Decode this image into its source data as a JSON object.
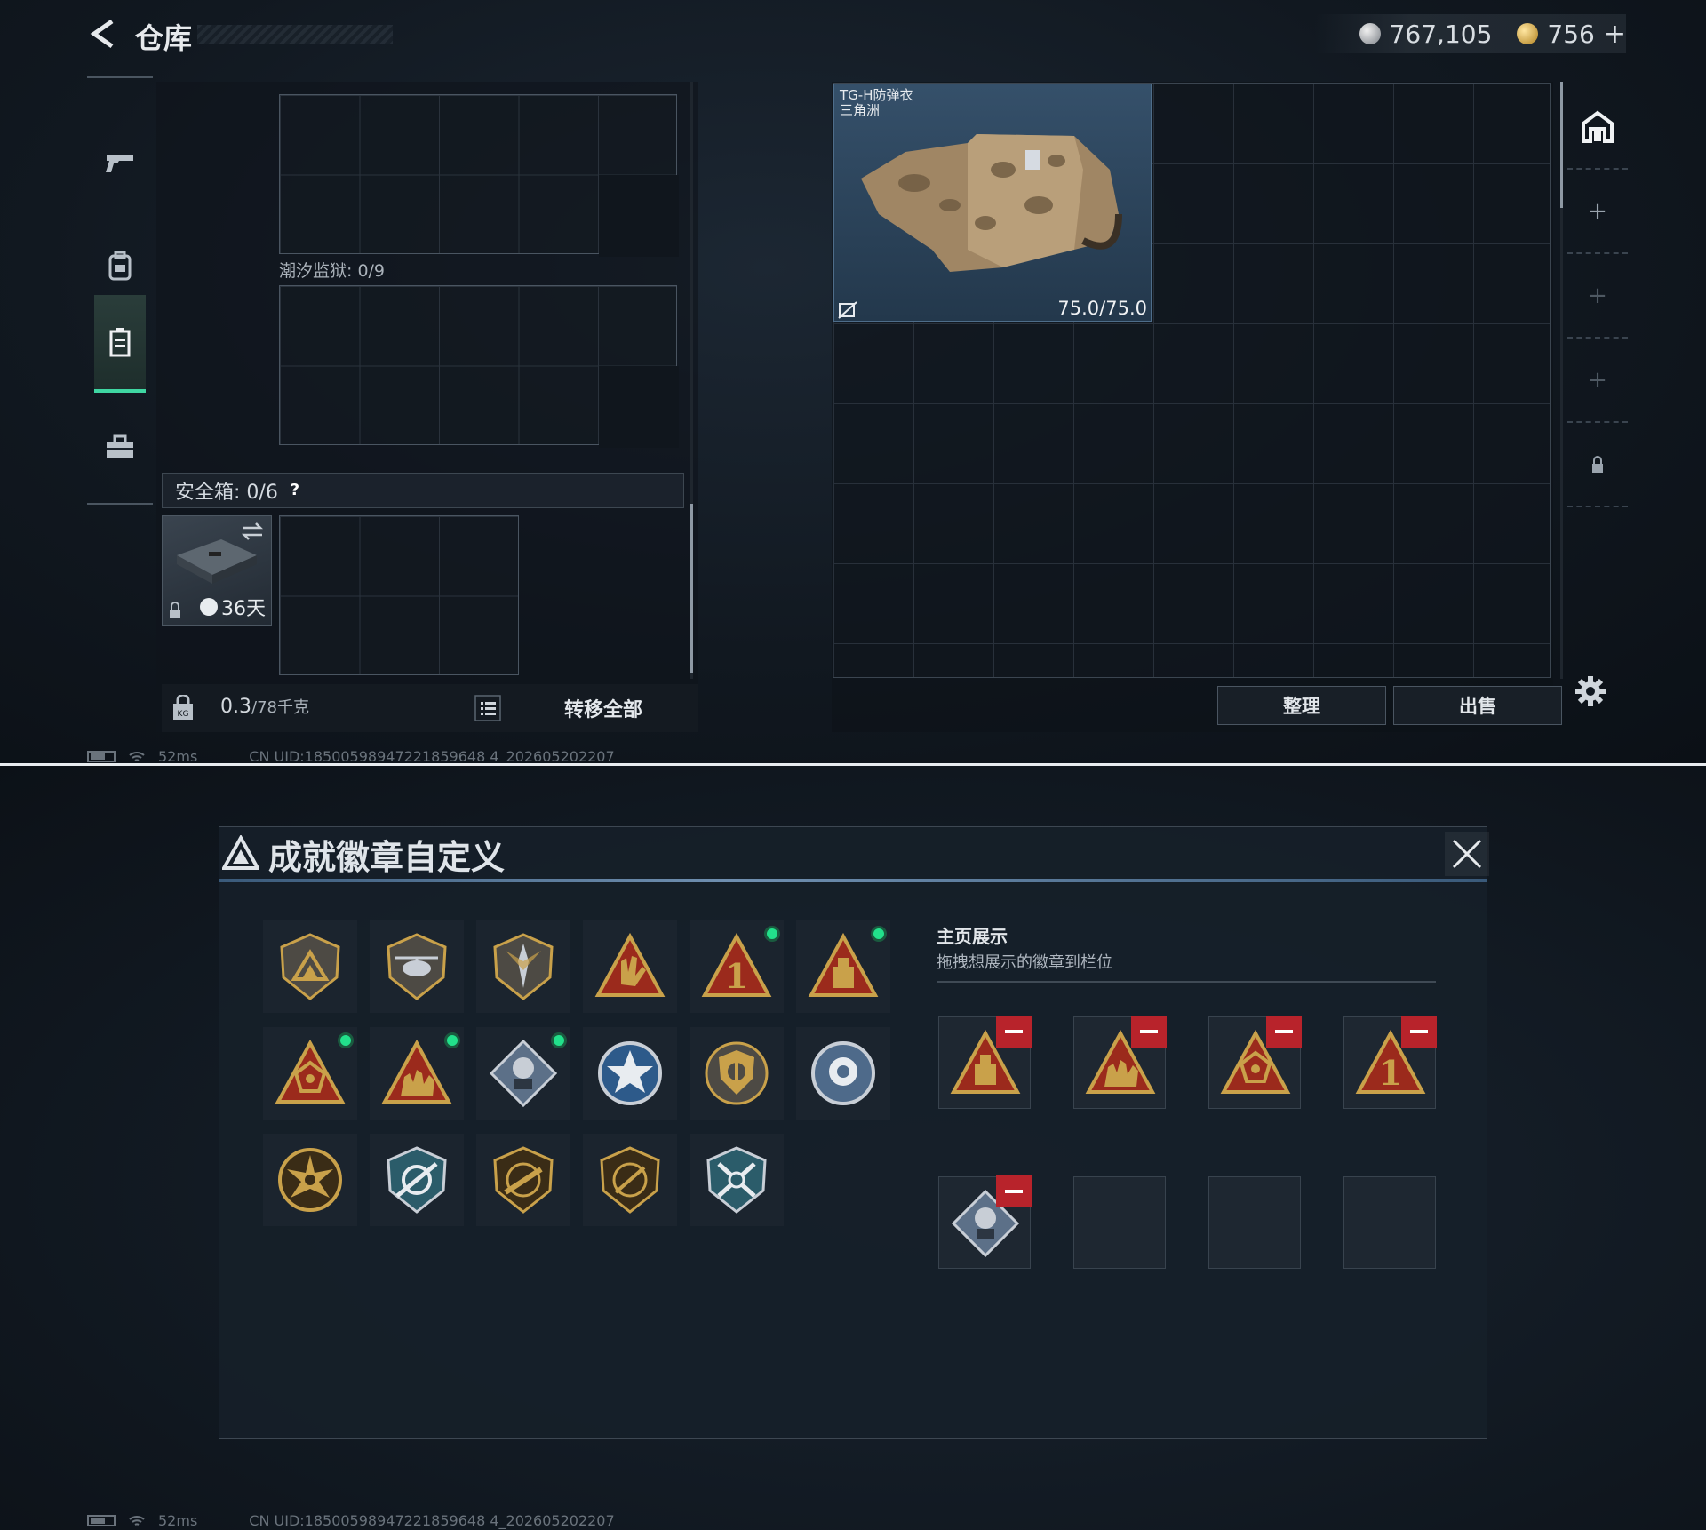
{
  "warehouse": {
    "title": "仓库",
    "currency": {
      "silver": "767,105",
      "gold": "756",
      "plus": "+"
    },
    "nav": [
      {
        "name": "weapons-nav-icon"
      },
      {
        "name": "gear-nav-icon"
      },
      {
        "name": "container-nav-icon",
        "active": true
      },
      {
        "name": "toolbox-nav-icon"
      }
    ],
    "slots": [
      {
        "label": "潮汐监狱: 0/9"
      }
    ],
    "safe_box": {
      "label": "安全箱: 0/6",
      "help": "?",
      "days": "36天"
    },
    "weight": {
      "current": "0.3",
      "max": "/78千克"
    },
    "transfer_all": "转移全部",
    "vest": {
      "name_line1": "TG-H防弹衣",
      "name_line2": "三角洲",
      "durability": "75.0/75.0"
    },
    "buttons": {
      "organize": "整理",
      "sell": "出售"
    },
    "side_tabs": [
      "+",
      "+",
      "+"
    ]
  },
  "status_bar": {
    "ping": "52ms",
    "uid": "CN UID:18500598947221859648 4_202605202207"
  },
  "badge_dialog": {
    "title": "成就徽章自定义",
    "section_title": "主页展示",
    "section_subtitle": "拖拽想展示的徽章到栏位",
    "badges": [
      {
        "icon": "mountain-shield-badge",
        "selected": false
      },
      {
        "icon": "helicopter-shield-badge",
        "selected": false
      },
      {
        "icon": "dagger-shield-badge",
        "selected": false
      },
      {
        "icon": "hand-triangle-badge",
        "selected": false
      },
      {
        "icon": "number-one-triangle-badge",
        "selected": true
      },
      {
        "icon": "vault-triangle-badge",
        "selected": true
      },
      {
        "icon": "dice-triangle-badge",
        "selected": true
      },
      {
        "icon": "soldiers-triangle-badge",
        "selected": true
      },
      {
        "icon": "diamond-rose-badge",
        "selected": true
      },
      {
        "icon": "star-emblem-badge",
        "selected": false
      },
      {
        "icon": "crest-shield-badge",
        "selected": false
      },
      {
        "icon": "flower-emblem-badge",
        "selected": false
      },
      {
        "icon": "sunburst-badge",
        "selected": false
      },
      {
        "icon": "blue-sniper-badge",
        "selected": false
      },
      {
        "icon": "rifle-shield-badge",
        "selected": false
      },
      {
        "icon": "pistol-shield-badge",
        "selected": false
      },
      {
        "icon": "blue-crossed-weapons-badge",
        "selected": false
      }
    ],
    "showcase": [
      "vault-triangle-badge",
      "soldiers-triangle-badge",
      "dice-triangle-badge",
      "number-one-triangle-badge",
      "diamond-rose-badge",
      "",
      "",
      ""
    ],
    "colors": {
      "selected_dot": "#22e08b",
      "remove": "#b8232b",
      "accent": "#3fd6a2"
    }
  }
}
